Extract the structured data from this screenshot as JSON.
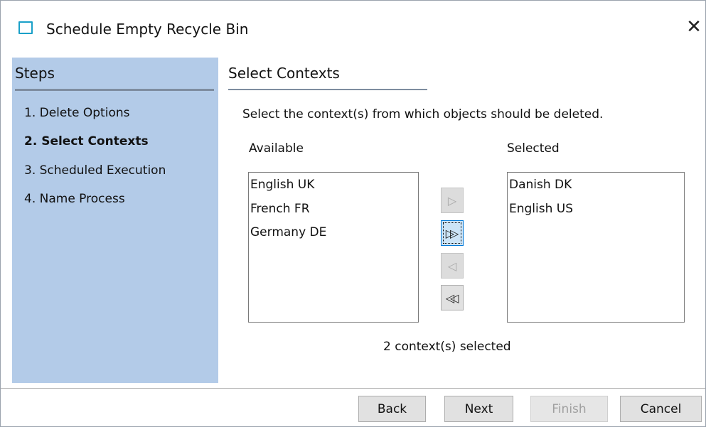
{
  "window": {
    "title": "Schedule Empty Recycle Bin",
    "icon": "window-icon",
    "close_icon": "close-icon",
    "close_glyph": "✕"
  },
  "steps": {
    "header": "Steps",
    "items": [
      {
        "label": "1. Delete Options",
        "active": false
      },
      {
        "label": "2. Select Contexts",
        "active": true
      },
      {
        "label": "3. Scheduled Execution",
        "active": false
      },
      {
        "label": "4. Name Process",
        "active": false
      }
    ]
  },
  "content": {
    "title": "Select Contexts",
    "instruction": "Select the context(s) from which objects should be deleted.",
    "available_label": "Available",
    "selected_label": "Selected",
    "available": [
      "English UK",
      "French FR",
      "Germany DE"
    ],
    "selected": [
      "Danish DK",
      "English US"
    ],
    "status": "2 context(s) selected"
  },
  "move_buttons": [
    {
      "name": "move-right-button",
      "icon": "arrow-right-icon",
      "glyph": "▷",
      "enabled": false
    },
    {
      "name": "move-all-right-button",
      "icon": "double-arrow-right-icon",
      "glyph": "▷▷",
      "enabled": true,
      "focused": true
    },
    {
      "name": "move-left-button",
      "icon": "arrow-left-icon",
      "glyph": "◁",
      "enabled": false
    },
    {
      "name": "move-all-left-button",
      "icon": "double-arrow-left-icon",
      "glyph": "◁◁",
      "enabled": true
    }
  ],
  "buttons": {
    "back": "Back",
    "next": "Next",
    "finish": "Finish",
    "cancel": "Cancel"
  },
  "colors": {
    "steps_bg": "#b3cbe8",
    "accent": "#0078d7",
    "title_icon": "#1aa0c8"
  }
}
